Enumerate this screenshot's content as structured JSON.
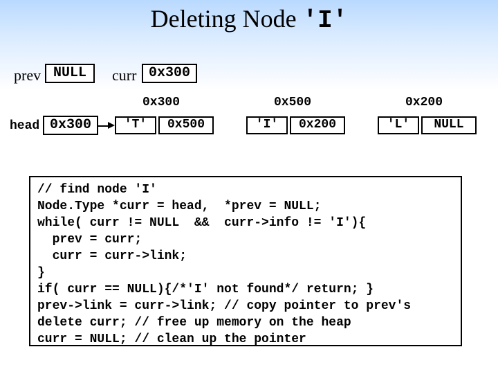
{
  "title": {
    "serif_part": "Deleting Node ",
    "mono_part": "'I'"
  },
  "prev": {
    "label": "prev",
    "value": "NULL"
  },
  "curr": {
    "label": "curr",
    "value": "0x300"
  },
  "head": {
    "label": "head",
    "value": "0x300"
  },
  "nodes": [
    {
      "addr": "0x300",
      "info": "'T'",
      "link": "0x500"
    },
    {
      "addr": "0x500",
      "info": "'I'",
      "link": "0x200"
    },
    {
      "addr": "0x200",
      "info": "'L'",
      "link": "NULL"
    }
  ],
  "code": "// find node 'I'\nNode.Type *curr = head,  *prev = NULL;\nwhile( curr != NULL  &&  curr->info != 'I'){\n  prev = curr;\n  curr = curr->link;\n}\nif( curr == NULL){/*'I' not found*/ return; }\nprev->link = curr->link; // copy pointer to prev's\ndelete curr; // free up memory on the heap\ncurr = NULL; // clean up the pointer"
}
